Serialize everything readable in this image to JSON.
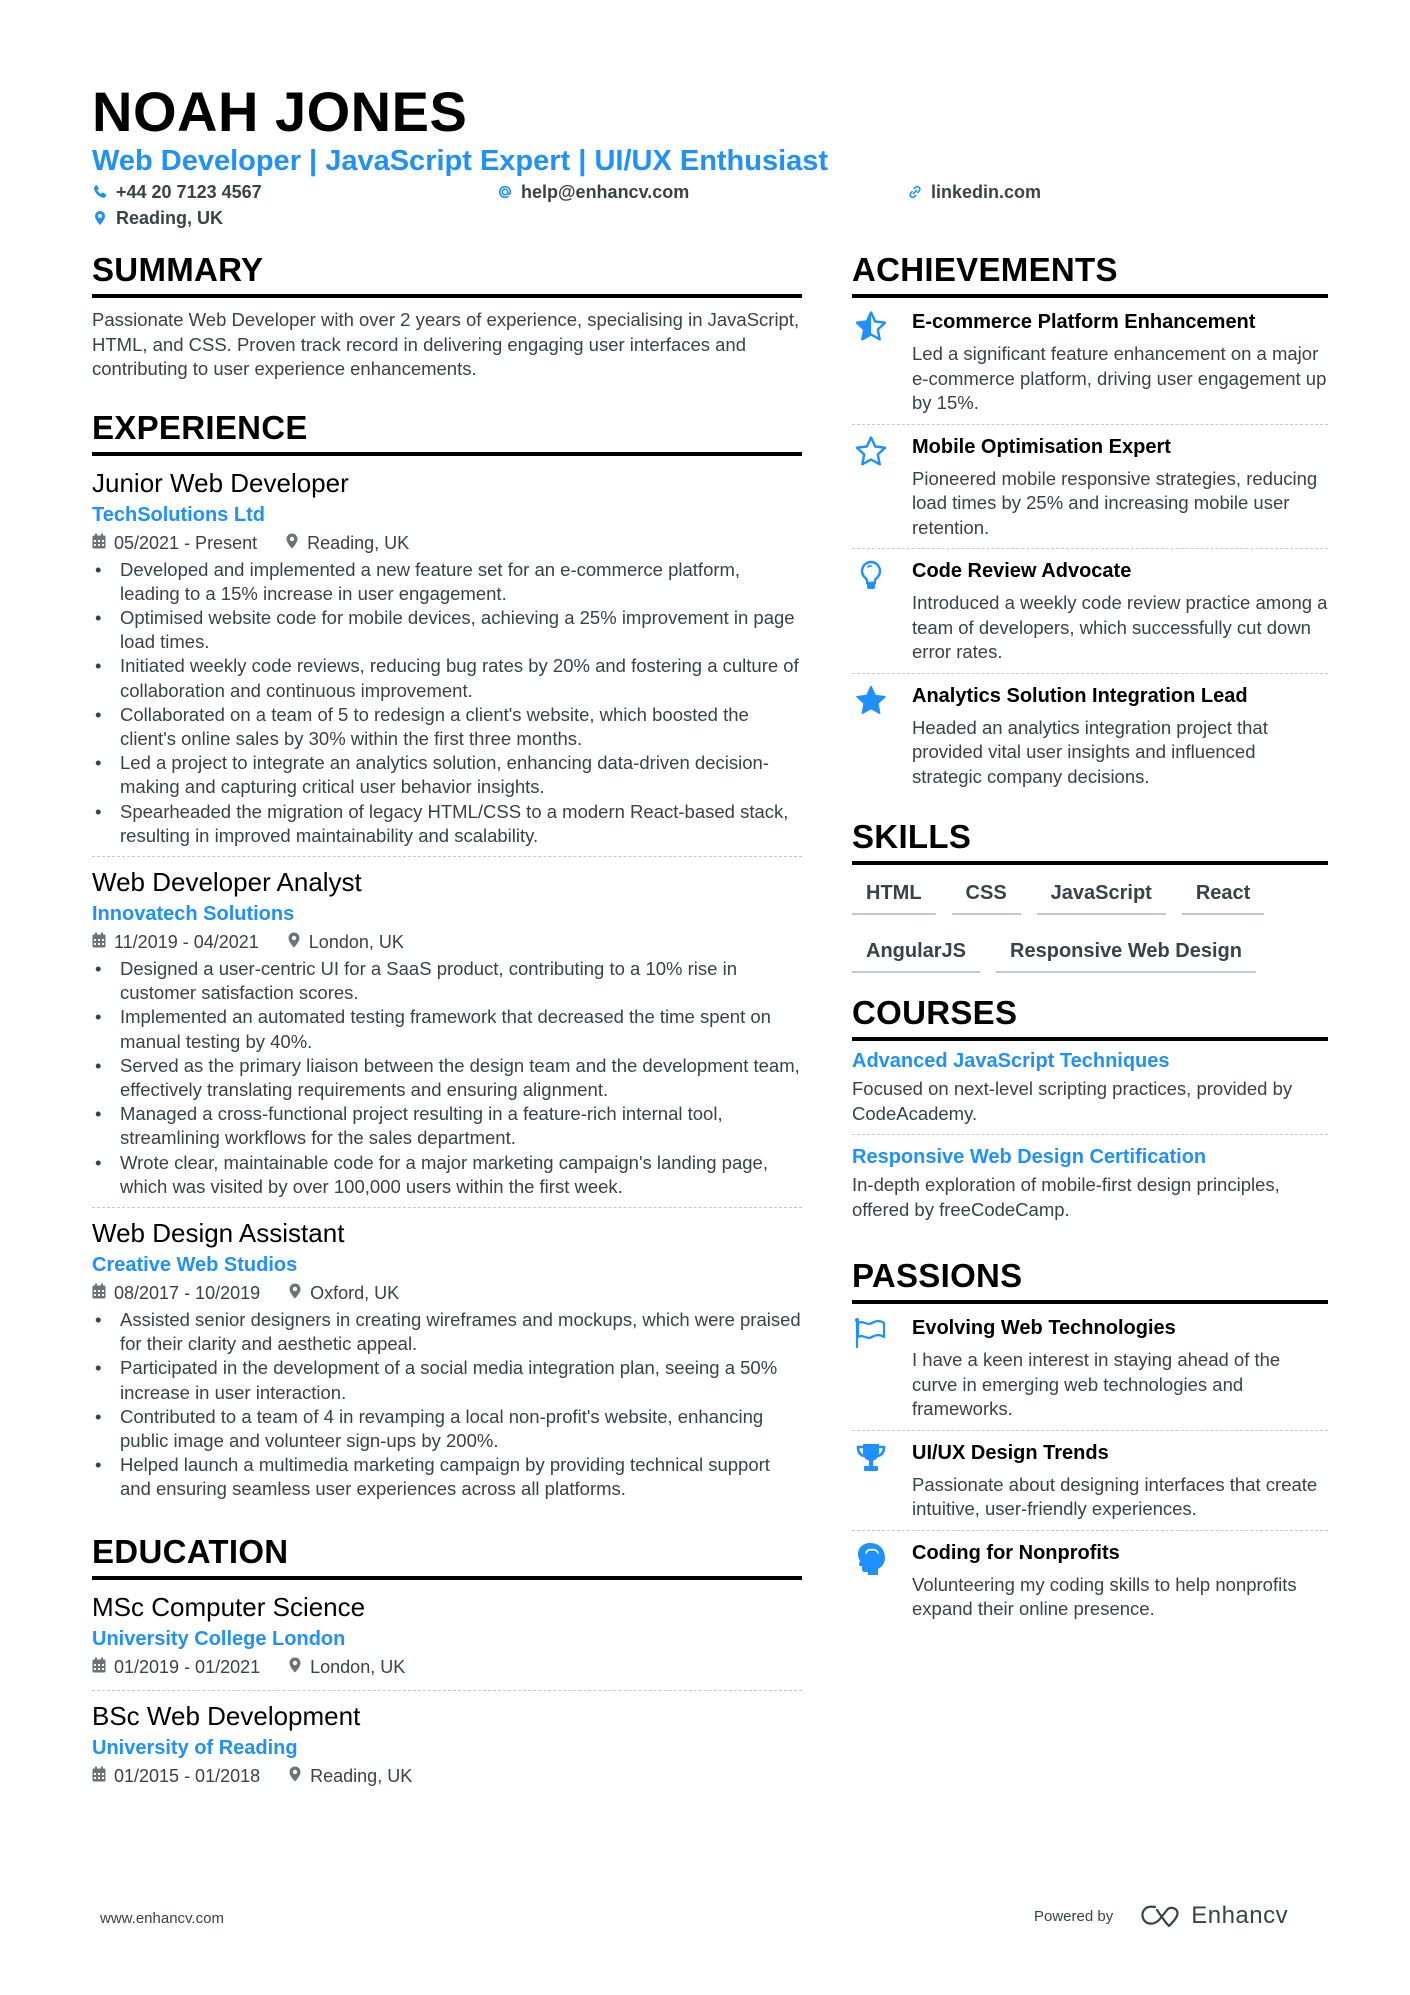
{
  "header": {
    "name": "NOAH JONES",
    "title": "Web Developer | JavaScript Expert | UI/UX Enthusiast",
    "phone": "+44 20 7123 4567",
    "email": "help@enhancv.com",
    "link": "linkedin.com",
    "location": "Reading, UK",
    "icons": {
      "phone": "phone-icon",
      "email": "at-icon",
      "link": "link-icon",
      "location": "map-pin-icon"
    }
  },
  "colors": {
    "accent": "#1e90ff",
    "text": "#384347",
    "heading": "#000000"
  },
  "summary": {
    "title": "SUMMARY",
    "text": "Passionate Web Developer with over 2 years of experience, specialising in JavaScript, HTML, and CSS. Proven track record in delivering engaging user interfaces and contributing to user experience enhancements."
  },
  "experience": {
    "title": "EXPERIENCE",
    "items": [
      {
        "role": "Junior Web Developer",
        "company": "TechSolutions Ltd",
        "dates": "05/2021 - Present",
        "location": "Reading, UK",
        "bullets": [
          "Developed and implemented a new feature set for an e-commerce platform, leading to a 15% increase in user engagement.",
          "Optimised website code for mobile devices, achieving a 25% improvement in page load times.",
          "Initiated weekly code reviews, reducing bug rates by 20% and fostering a culture of collaboration and continuous improvement.",
          "Collaborated on a team of 5 to redesign a client's website, which boosted the client's online sales by 30% within the first three months.",
          "Led a project to integrate an analytics solution, enhancing data-driven decision-making and capturing critical user behavior insights.",
          "Spearheaded the migration of legacy HTML/CSS to a modern React-based stack, resulting in improved maintainability and scalability."
        ]
      },
      {
        "role": "Web Developer Analyst",
        "company": "Innovatech Solutions",
        "dates": "11/2019 - 04/2021",
        "location": "London, UK",
        "bullets": [
          "Designed a user-centric UI for a SaaS product, contributing to a 10% rise in customer satisfaction scores.",
          "Implemented an automated testing framework that decreased the time spent on manual testing by 40%.",
          "Served as the primary liaison between the design team and the development team, effectively translating requirements and ensuring alignment.",
          "Managed a cross-functional project resulting in a feature-rich internal tool, streamlining workflows for the sales department.",
          "Wrote clear, maintainable code for a major marketing campaign's landing page, which was visited by over 100,000 users within the first week."
        ]
      },
      {
        "role": "Web Design Assistant",
        "company": "Creative Web Studios",
        "dates": "08/2017 - 10/2019",
        "location": "Oxford, UK",
        "bullets": [
          "Assisted senior designers in creating wireframes and mockups, which were praised for their clarity and aesthetic appeal.",
          "Participated in the development of a social media integration plan, seeing a 50% increase in user interaction.",
          "Contributed to a team of 4 in revamping a local non-profit's website, enhancing public image and volunteer sign-ups by 200%.",
          "Helped launch a multimedia marketing campaign by providing technical support and ensuring seamless user experiences across all platforms."
        ]
      }
    ]
  },
  "education": {
    "title": "EDUCATION",
    "items": [
      {
        "degree": "MSc Computer Science",
        "school": "University College London",
        "dates": "01/2019 - 01/2021",
        "location": "London, UK"
      },
      {
        "degree": "BSc Web Development",
        "school": "University of Reading",
        "dates": "01/2015 - 01/2018",
        "location": "Reading, UK"
      }
    ]
  },
  "achievements": {
    "title": "ACHIEVEMENTS",
    "items": [
      {
        "icon": "star-half-icon",
        "title": "E-commerce Platform Enhancement",
        "desc": "Led a significant feature enhancement on a major e-commerce platform, driving user engagement up by 15%."
      },
      {
        "icon": "star-outline-icon",
        "title": "Mobile Optimisation Expert",
        "desc": "Pioneered mobile responsive strategies, reducing load times by 25% and increasing mobile user retention."
      },
      {
        "icon": "lightbulb-icon",
        "title": "Code Review Advocate",
        "desc": "Introduced a weekly code review practice among a team of developers, which successfully cut down error rates."
      },
      {
        "icon": "star-filled-icon",
        "title": "Analytics Solution Integration Lead",
        "desc": "Headed an analytics integration project that provided vital user insights and influenced strategic company decisions."
      }
    ]
  },
  "skills": {
    "title": "SKILLS",
    "items": [
      "HTML",
      "CSS",
      "JavaScript",
      "React",
      "AngularJS",
      "Responsive Web Design"
    ]
  },
  "courses": {
    "title": "COURSES",
    "items": [
      {
        "title": "Advanced JavaScript Techniques",
        "desc": "Focused on next-level scripting practices, provided by CodeAcademy."
      },
      {
        "title": "Responsive Web Design Certification",
        "desc": "In-depth exploration of mobile-first design principles, offered by freeCodeCamp."
      }
    ]
  },
  "passions": {
    "title": "PASSIONS",
    "items": [
      {
        "icon": "flag-icon",
        "title": "Evolving Web Technologies",
        "desc": "I have a keen interest in staying ahead of the curve in emerging web technologies and frameworks."
      },
      {
        "icon": "trophy-icon",
        "title": "UI/UX Design Trends",
        "desc": "Passionate about designing interfaces that create intuitive, user-friendly experiences."
      },
      {
        "icon": "head-brain-icon",
        "title": "Coding for Nonprofits",
        "desc": "Volunteering my coding skills to help nonprofits expand their online presence."
      }
    ]
  },
  "footer": {
    "website": "www.enhancv.com",
    "powered_by": "Powered by",
    "brand": "Enhancv"
  }
}
